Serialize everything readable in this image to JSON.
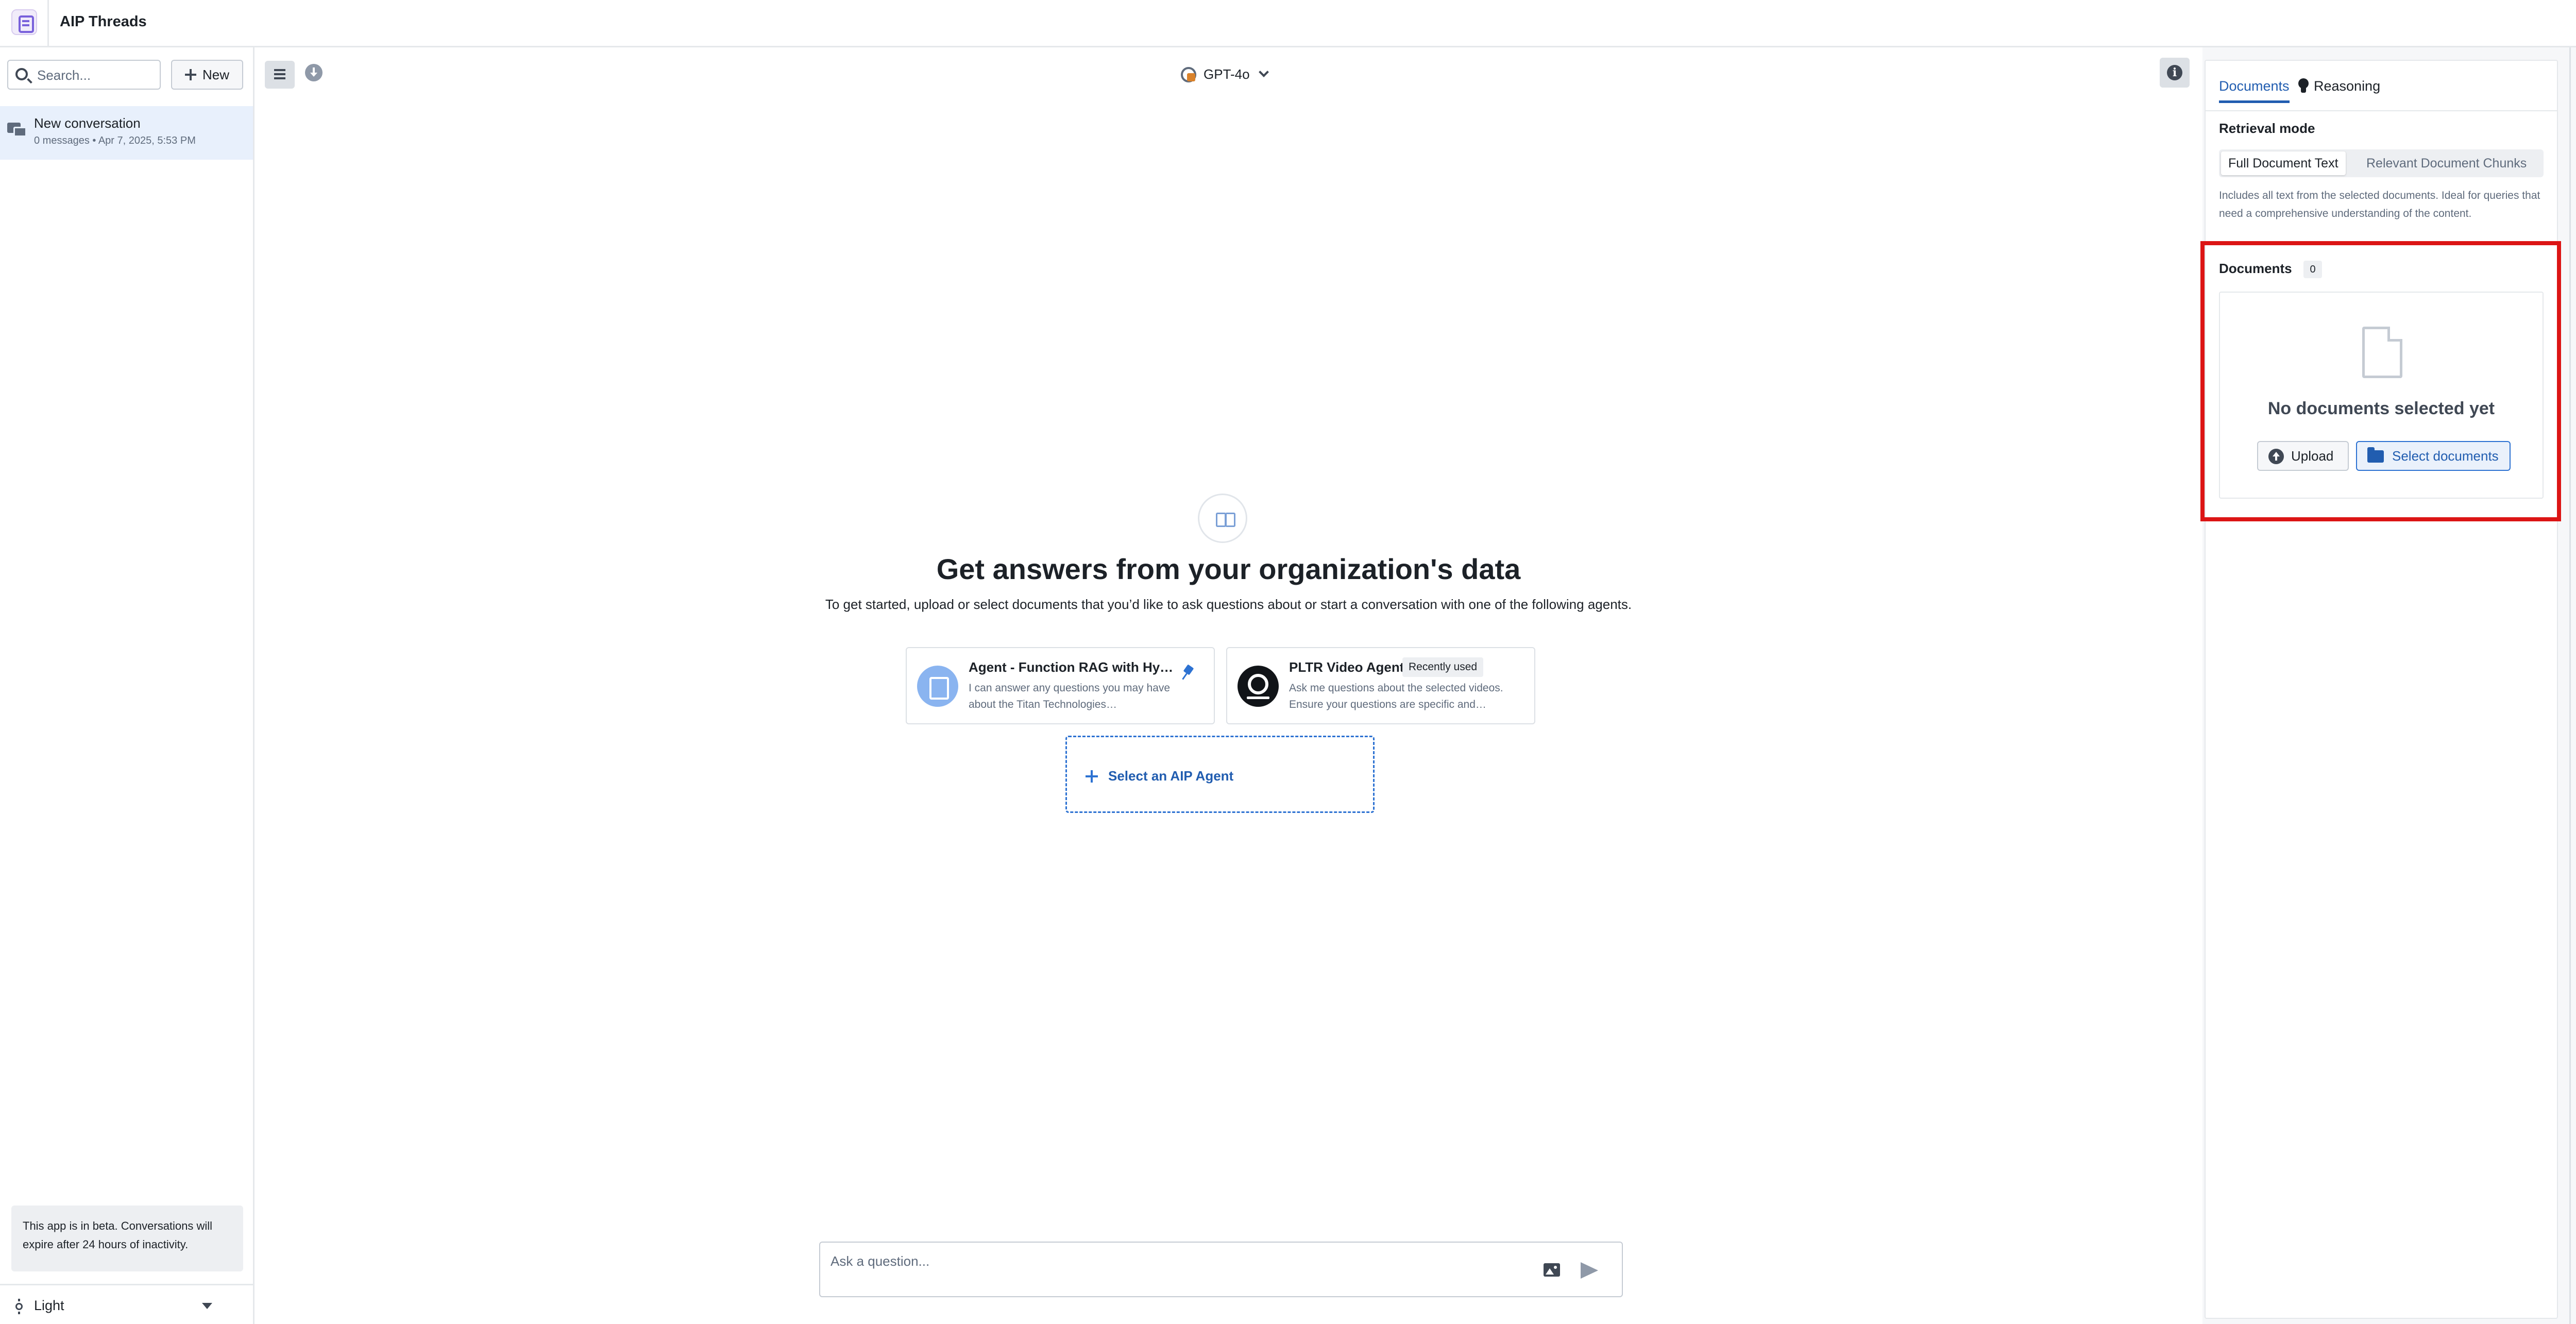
{
  "app": {
    "title": "AIP Threads"
  },
  "sidebar": {
    "search": {
      "placeholder": "Search..."
    },
    "new_label": "New",
    "conversations": [
      {
        "title": "New conversation",
        "meta": "0 messages • Apr 7, 2025, 5:53 PM"
      }
    ],
    "beta_note": "This app is in beta. Conversations will expire after 24 hours of inactivity.",
    "theme": {
      "label": "Light",
      "icon": "sun-icon"
    }
  },
  "toolbar": {
    "model": "GPT-4o"
  },
  "main": {
    "title": "Get answers from your organization's data",
    "subtitle": "To get started, upload or select documents that you’d like to ask questions about or start a conversation with one of the following agents.",
    "agents": [
      {
        "name": "Agent - Function RAG with Hy…",
        "desc": "I can answer any questions you may have about the Titan Technologies…",
        "pinned": true
      },
      {
        "name": "PLTR Video Agent",
        "tag": "Recently used",
        "desc": "Ask me questions about the selected videos. Ensure your questions are specific and…"
      }
    ],
    "select_agent_label": "Select an AIP Agent",
    "composer": {
      "placeholder": "Ask a question..."
    }
  },
  "right_panel": {
    "tabs": [
      "Documents",
      "Reasoning"
    ],
    "active_tab": "Documents",
    "retrieval": {
      "label": "Retrieval mode",
      "options": [
        "Full Document Text",
        "Relevant Document Chunks"
      ],
      "selected": "Full Document Text",
      "description": "Includes all text from the selected documents. Ideal for queries that need a comprehensive understanding of the content."
    },
    "documents": {
      "label": "Documents",
      "count": "0",
      "empty_text": "No documents selected yet",
      "upload_label": "Upload",
      "select_label": "Select documents"
    }
  },
  "colors": {
    "accent": "#215db0",
    "highlight": "#dc1515",
    "selected_row": "#e8f0fc"
  }
}
